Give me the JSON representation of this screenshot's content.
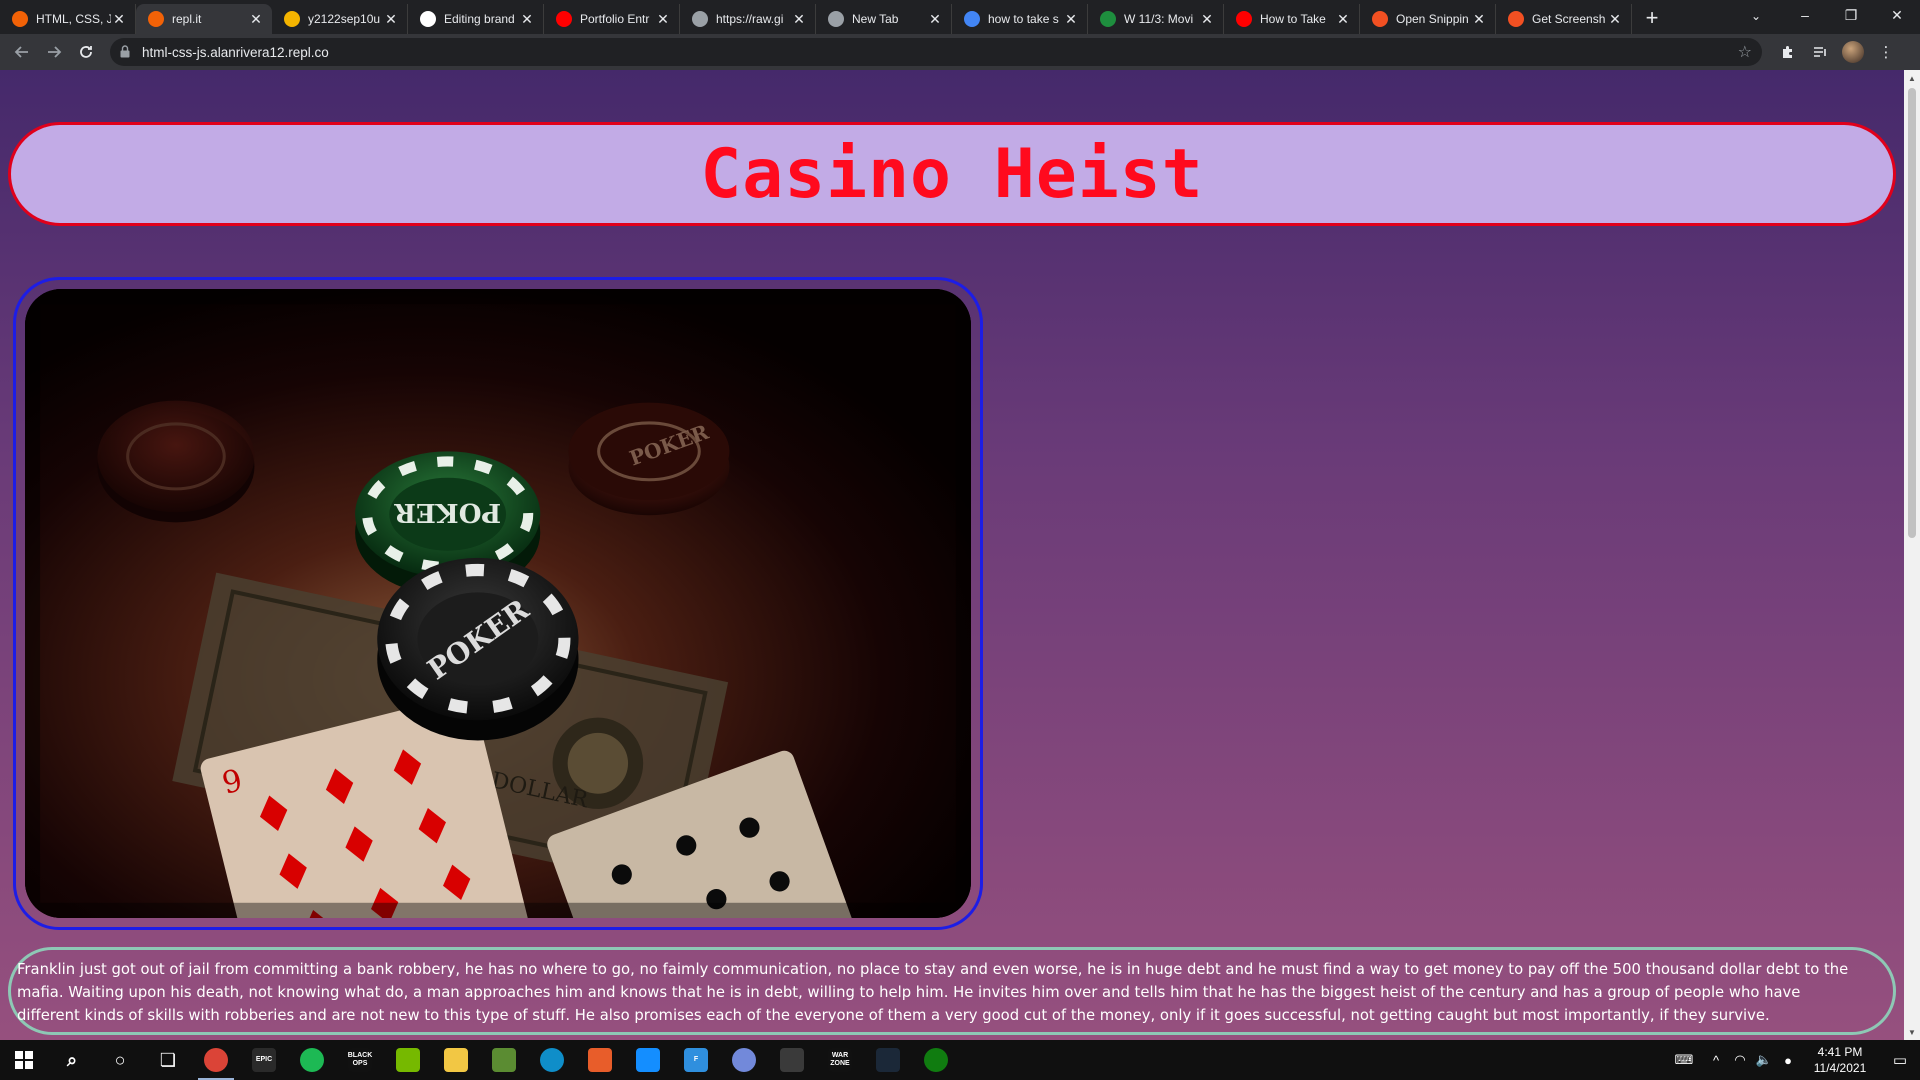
{
  "browser": {
    "tabs": [
      {
        "label": "HTML, CSS, J",
        "icon": "replit-icon",
        "color": "#f26207",
        "active": false
      },
      {
        "label": "repl.it",
        "icon": "replit-icon",
        "color": "#f26207",
        "active": true
      },
      {
        "label": "y2122sep10u",
        "icon": "slides-icon",
        "color": "#f4b400",
        "active": false
      },
      {
        "label": "Editing brand",
        "icon": "github-icon",
        "color": "#ffffff",
        "active": false
      },
      {
        "label": "Portfolio Entr",
        "icon": "youtube-icon",
        "color": "#ff0000",
        "active": false
      },
      {
        "label": "https://raw.gi",
        "icon": "globe-icon",
        "color": "#9aa0a6",
        "active": false
      },
      {
        "label": "New Tab",
        "icon": "chrome-icon",
        "color": "#9aa0a6",
        "active": false
      },
      {
        "label": "how to take s",
        "icon": "google-icon",
        "color": "#4285f4",
        "active": false
      },
      {
        "label": "W 11/3: Movi",
        "icon": "classroom-icon",
        "color": "#1e8e3e",
        "active": false
      },
      {
        "label": "How to Take",
        "icon": "youtube-icon",
        "color": "#ff0000",
        "active": false
      },
      {
        "label": "Open Snippin",
        "icon": "microsoft-icon",
        "color": "#f25022",
        "active": false
      },
      {
        "label": "Get Screensh",
        "icon": "microsoft-icon",
        "color": "#f25022",
        "active": false
      }
    ],
    "url": "html-css-js.alanrivera12.repl.co"
  },
  "page": {
    "title": "Casino Heist",
    "story": "Franklin just got out of jail from committing a bank robbery, he has no where to go, no faimly communication, no place to stay and even worse, he is in huge debt and he must find a way to get money to pay off the 500 thousand dollar debt to the mafia. Waiting upon his death, not knowing what do, a man approaches him and knows that he is in debt, willing to help him. He invites him over and tells him that he has the biggest heist of the century and has a group of people who have different kinds of skills with robberies and are not new to this type of stuff. He also promises each of the everyone of them a very good cut of the money, only if it goes successful, not getting caught but most importantly, if they survive.",
    "image_labels": {
      "chip_text": "POKER",
      "card_rank": "9"
    }
  },
  "colors": {
    "title_text": "#ff0a1e",
    "title_bg": "#c2abe6",
    "image_border": "#1d1de6",
    "story_border": "#8ec8b5"
  },
  "taskbar": {
    "apps": [
      {
        "name": "search-icon"
      },
      {
        "name": "cortana-icon"
      },
      {
        "name": "task-view-icon"
      },
      {
        "name": "chrome-icon"
      },
      {
        "name": "epic-games-icon",
        "label": "EPIC"
      },
      {
        "name": "spotify-icon"
      },
      {
        "name": "black-ops-icon",
        "label": "BLACK OPS"
      },
      {
        "name": "nvidia-icon"
      },
      {
        "name": "file-explorer-icon"
      },
      {
        "name": "minecraft-icon"
      },
      {
        "name": "edge-icon"
      },
      {
        "name": "mail-icon"
      },
      {
        "name": "battlenet-icon"
      },
      {
        "name": "fortnite-icon",
        "label": "F"
      },
      {
        "name": "discord-icon"
      },
      {
        "name": "steam-vr-icon"
      },
      {
        "name": "warzone-icon",
        "label": "WAR ZONE"
      },
      {
        "name": "steam-icon"
      },
      {
        "name": "xbox-icon"
      }
    ],
    "time": "4:41 PM",
    "date": "11/4/2021"
  }
}
